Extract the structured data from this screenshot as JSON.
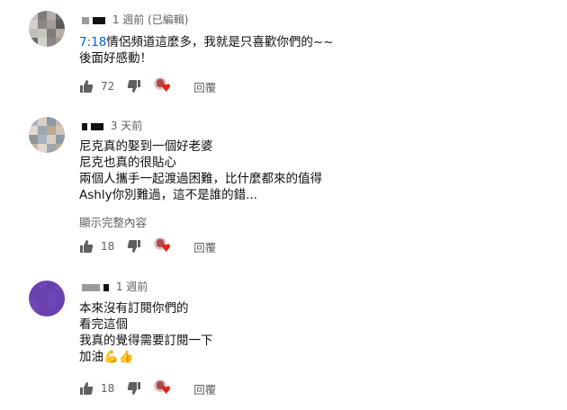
{
  "comments": [
    {
      "time": "1 週前",
      "edited": "(已編輯)",
      "timestamp": "7:18",
      "lines": [
        "情侶頻道這麼多，我就是只喜歡你們的~~",
        "後面好感動！"
      ],
      "likes": "72",
      "reply_label": "回覆",
      "avatar_colors": [
        "#c9c4bd",
        "#7d7c7a",
        "#b4aea7",
        "#6e6b68",
        "#d4d0cb",
        "#8a8784",
        "#a29d97",
        "#5c5a58",
        "#c2bdb7"
      ]
    },
    {
      "time": "3 天前",
      "lines": [
        "尼克真的娶到一個好老婆",
        "尼克也真的很貼心",
        "兩個人攜手一起渡過困難，比什麼都來的值得",
        "Ashly你別難過，這不是誰的錯..."
      ],
      "show_more": "顯示完整內容",
      "likes": "18",
      "reply_label": "回覆",
      "avatar_colors": [
        "#a8b4c0",
        "#d8cfc4",
        "#8c9aa8",
        "#c7b8a6",
        "#e2d8cc",
        "#9fa6ad",
        "#b9a894",
        "#cfc6bb",
        "#8f969c"
      ]
    },
    {
      "time": "1 週前",
      "lines": [
        "本來沒有訂閱你們的",
        "看完這個",
        "我真的覺得需要訂閱一下",
        "加油"
      ],
      "emoji": "💪👍",
      "likes": "18",
      "reply_label": "回覆",
      "avatar_colors": [
        "#6a3fb0",
        "#6f44b6",
        "#6840ad",
        "#7247b8",
        "#6b41b2",
        "#6942ae",
        "#6e43b5",
        "#6c42b0",
        "#7046b7"
      ]
    }
  ],
  "colors": {
    "link": "#065fd4",
    "secondary_text": "#606060",
    "heart": "#e62117"
  },
  "icons": [
    "thumb-up-icon",
    "thumb-down-icon",
    "creator-heart-icon"
  ]
}
